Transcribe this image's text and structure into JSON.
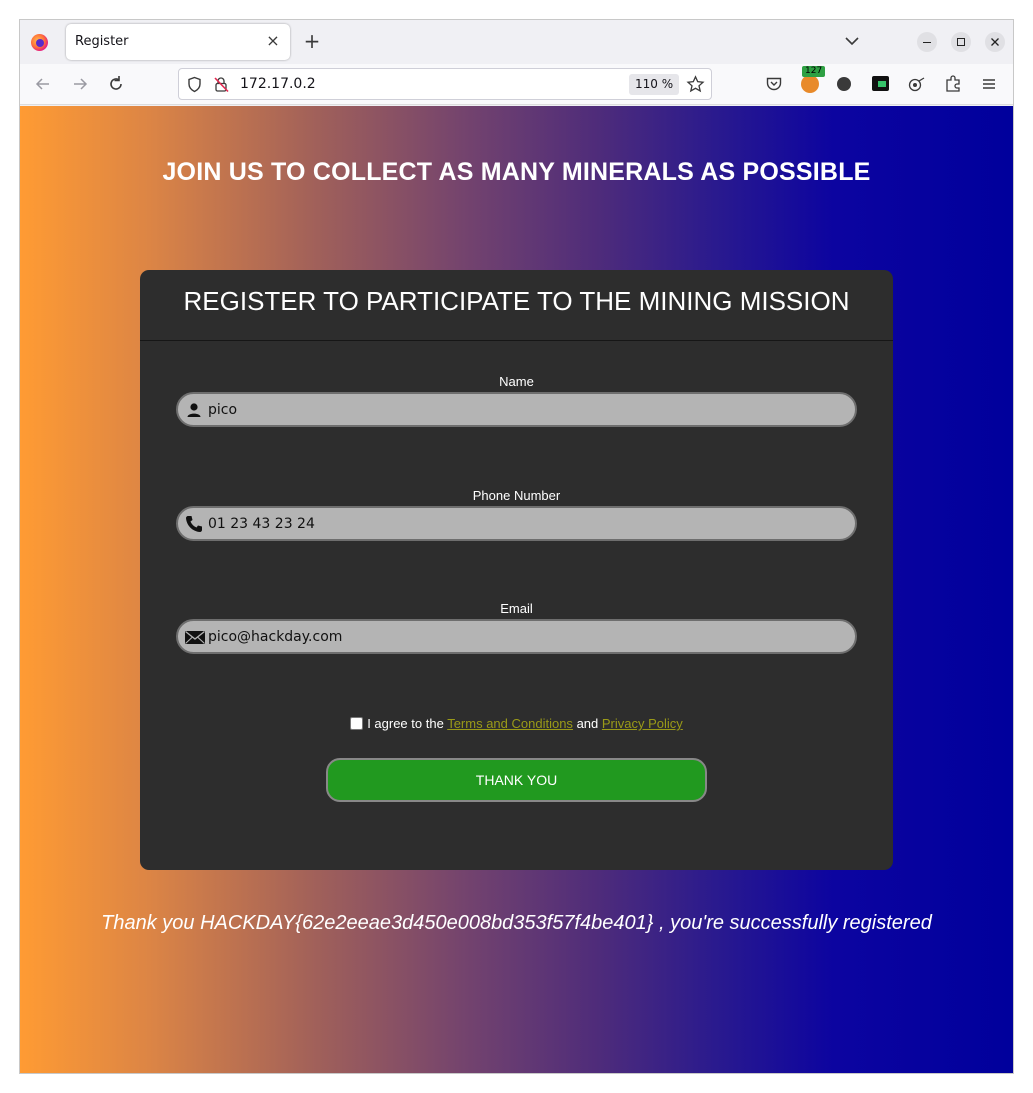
{
  "browser": {
    "tab_title": "Register",
    "tab_close": "×",
    "new_tab": "+",
    "url": "172.17.0.2",
    "zoom": "110 %",
    "extension_badge": "127",
    "icons": [
      "back-icon",
      "forward-icon",
      "reload-icon",
      "shield-icon",
      "insecure-lock-icon",
      "bookmark-star-icon",
      "pocket-icon",
      "extension-icon",
      "extensions-puzzle-icon",
      "menu-icon",
      "tab-list-icon"
    ],
    "window_controls": [
      "minimize",
      "maximize",
      "close"
    ]
  },
  "page": {
    "headline": "JOIN US TO COLLECT AS MANY MINERALS AS POSSIBLE",
    "card_title": "REGISTER TO PARTICIPATE TO THE MINING MISSION",
    "fields": {
      "name": {
        "label": "Name",
        "value": "pico",
        "icon": "user-icon"
      },
      "phone": {
        "label": "Phone Number",
        "value": "01 23 43 23 24",
        "icon": "phone-icon"
      },
      "email": {
        "label": "Email",
        "value": "pico@hackday.com",
        "icon": "envelope-icon"
      }
    },
    "agree": {
      "prefix": "I agree to the",
      "terms": "Terms and Conditions",
      "and": "and",
      "privacy": "Privacy Policy",
      "checked": false
    },
    "submit_label": "THANK YOU",
    "thanks_message": "Thank you HACKDAY{62e2eeae3d450e008bd353f57f4be401} , you're successfully registered"
  },
  "colors": {
    "gradient_start": "#ff9b33",
    "gradient_end": "#00009c",
    "card_bg": "#2d2d2d",
    "button_green": "#21991f",
    "link_olive": "#9a9a18"
  }
}
